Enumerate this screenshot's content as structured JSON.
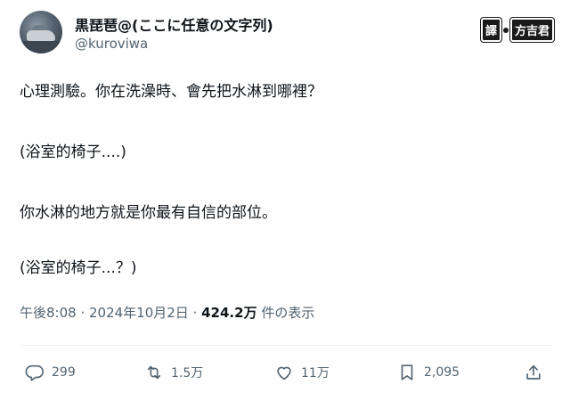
{
  "author": {
    "display_name": "黒琵琶@(ここに任意の文字列)",
    "handle": "@kuroviwa"
  },
  "translator_badge": {
    "left_text": "譯",
    "right_text": "方吉君"
  },
  "tweet": {
    "lines": [
      "心理測驗。你在洗澡時、會先把水淋到哪裡？",
      "(浴室的椅子....)",
      "你水淋的地方就是你最有自信的部位。",
      "(浴室的椅子...？)"
    ]
  },
  "meta": {
    "time": "午後8:08",
    "separator": " · ",
    "date": "2024年10月2日",
    "views_count": "424.2万",
    "views_label": "件の表示"
  },
  "actions": {
    "replies": "299",
    "retweets": "1.5万",
    "likes": "11万",
    "bookmarks": "2,095"
  },
  "icons": [
    "reply-icon",
    "retweet-icon",
    "like-icon",
    "bookmark-icon",
    "share-icon"
  ]
}
